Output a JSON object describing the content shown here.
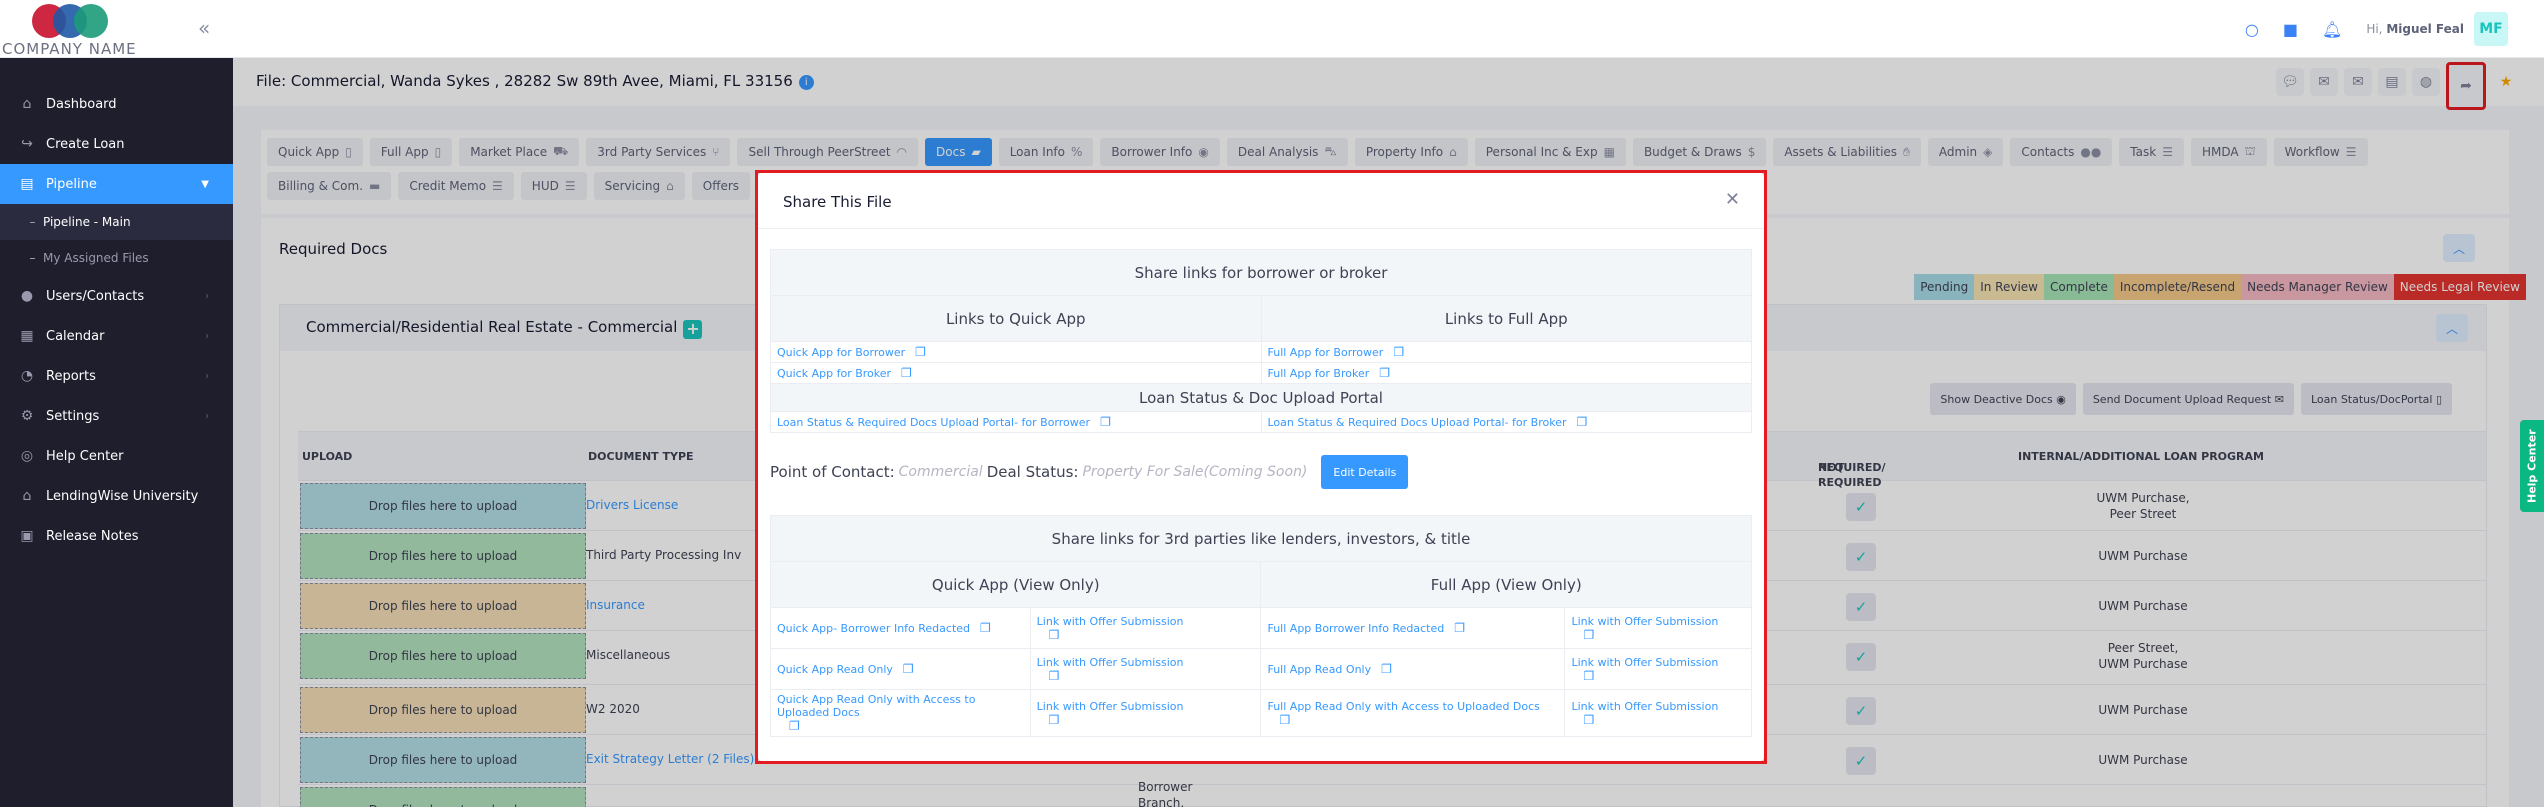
{
  "brand": {
    "company_name": "COMPANY NAME"
  },
  "topbar": {
    "greeting": "Hi,",
    "user_name": "Miguel Feal",
    "avatar_initials": "MF"
  },
  "sidebar": {
    "items": [
      {
        "label": "Dashboard",
        "icon": "home-icon"
      },
      {
        "label": "Create Loan",
        "icon": "create-loan-icon"
      },
      {
        "label": "Pipeline",
        "icon": "pipeline-icon"
      },
      {
        "label": "Users/Contacts",
        "icon": "users-icon"
      },
      {
        "label": "Calendar",
        "icon": "calendar-icon"
      },
      {
        "label": "Reports",
        "icon": "reports-icon"
      },
      {
        "label": "Settings",
        "icon": "gear-icon"
      },
      {
        "label": "Help Center",
        "icon": "help-icon"
      },
      {
        "label": "LendingWise University",
        "icon": "university-icon"
      },
      {
        "label": "Release Notes",
        "icon": "notes-icon"
      }
    ],
    "pipeline_sub": [
      "Pipeline - Main",
      "My Assigned Files"
    ]
  },
  "file": {
    "title": "File: Commercial, Wanda Sykes , 28282 Sw 89th Avee, Miami, FL 33156"
  },
  "tabs_row1": [
    "Quick App",
    "Full App",
    "Market Place",
    "3rd Party Services",
    "Sell Through PeerStreet",
    "Docs",
    "Loan Info",
    "Borrower Info",
    "Deal Analysis",
    "Property Info",
    "Personal Inc & Exp",
    "Budget & Draws",
    "Assets & Liabilities",
    "Admin",
    "Contacts",
    "Task",
    "HMDA",
    "Workflow"
  ],
  "tabs_row2": [
    "Billing & Com.",
    "Credit Memo",
    "HUD",
    "Servicing",
    "Offers"
  ],
  "required_docs": {
    "title": "Required Docs",
    "legend": [
      {
        "label": "Pending",
        "bg": "#a8dce8"
      },
      {
        "label": "In Review",
        "bg": "#f7e3b3"
      },
      {
        "label": "Complete",
        "bg": "#a6e3b6"
      },
      {
        "label": "Incomplete/Resend",
        "bg": "#f5c98a"
      },
      {
        "label": "Needs Manager Review",
        "bg": "#f4b9c4"
      },
      {
        "label": "Needs Legal Review",
        "bg": "#e3342f"
      }
    ],
    "section_title": "Commercial/Residential Real Estate  - Commercial",
    "buttons": [
      "Show Deactive Docs",
      "Send Document Upload Request",
      "Loan Status/DocPortal"
    ],
    "columns": {
      "upload": "UPLOAD",
      "document_type": "DOCUMENT TYPE",
      "required_1": "REQUIRED/",
      "required_2": "NOT REQUIRED",
      "program": "INTERNAL/ADDITIONAL LOAN PROGRAM"
    },
    "drop_label": "Drop files here to upload",
    "rows": [
      {
        "doc": "Drivers License",
        "link": true,
        "color": "#b4dde6",
        "program": [
          "UWM Purchase,",
          "Peer Street"
        ]
      },
      {
        "doc": "Third Party Processing Inv",
        "link": false,
        "color": "#b3e2bf",
        "program": [
          "UWM Purchase"
        ]
      },
      {
        "doc": "Insurance",
        "link": true,
        "color": "#f3ddb6",
        "program": [
          "UWM Purchase"
        ]
      },
      {
        "doc": "Miscellaneous",
        "link": false,
        "color": "#b3e2bf",
        "program": [
          "Peer Street,",
          "UWM Purchase"
        ]
      },
      {
        "doc": "W2 2020",
        "link": false,
        "color": "#f3ddb6",
        "program": [
          "UWM Purchase"
        ]
      },
      {
        "doc": "Exit Strategy Letter (2 Files)",
        "link": true,
        "color": "#b4dde6",
        "program": [
          "UWM Purchase"
        ]
      }
    ],
    "partial_text": [
      "Borrower",
      "Branch,"
    ]
  },
  "help_center_tab": "Help Center",
  "modal": {
    "title": "Share This File",
    "section1_title": "Share links for borrower or broker",
    "quick_app_heading": "Links to Quick App",
    "full_app_heading": "Links to Full App",
    "quick_links": [
      "Quick App for Borrower",
      "Quick App for Broker"
    ],
    "full_links": [
      "Full App for Borrower",
      "Full App for Broker"
    ],
    "portal_heading": "Loan Status & Doc Upload Portal",
    "portal_borrower": "Loan Status & Required Docs Upload Portal- for Borrower",
    "portal_broker": "Loan Status & Required Docs Upload Portal- for Broker",
    "poc_label": "Point of Contact:",
    "poc_value": "Commercial",
    "deal_status_label": "Deal Status:",
    "deal_status_value": "Property For Sale(Coming Soon)",
    "edit_button": "Edit Details",
    "section2_title": "Share links for 3rd parties like lenders, investors, & title",
    "quick_view_heading": "Quick App (View Only)",
    "full_view_heading": "Full App (View Only)",
    "view_rows": [
      {
        "quick": "Quick App- Borrower Info Redacted",
        "full": "Full App Borrower Info Redacted"
      },
      {
        "quick": "Quick App Read Only",
        "full": "Full App Read Only"
      },
      {
        "quick": "Quick App Read Only with Access to Uploaded Docs",
        "full": "Full App Read Only with Access to Uploaded Docs"
      }
    ],
    "offer_link": "Link with Offer Submission"
  }
}
